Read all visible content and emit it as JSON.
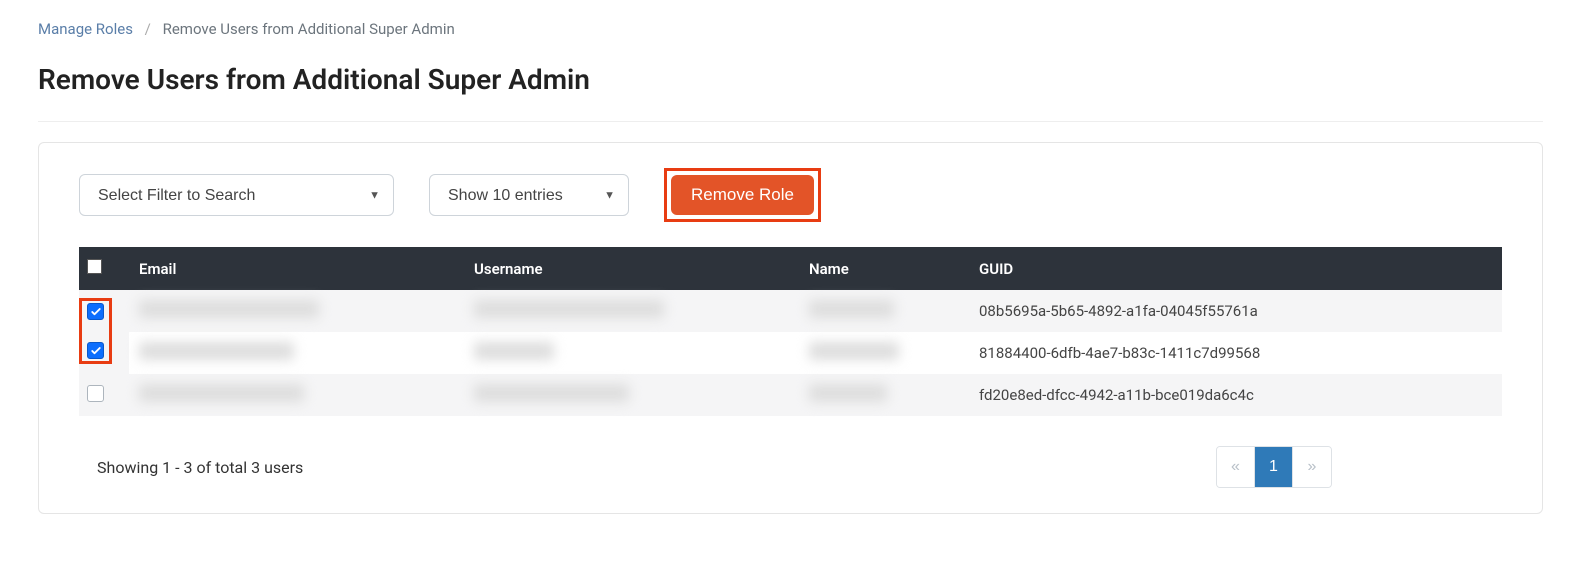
{
  "breadcrumb": {
    "root": "Manage Roles",
    "current": "Remove Users from Additional Super Admin"
  },
  "title": "Remove Users from Additional Super Admin",
  "toolbar": {
    "filter_placeholder": "Select Filter to Search",
    "entries_label": "Show 10 entries",
    "remove_label": "Remove Role"
  },
  "table": {
    "headers": {
      "email": "Email",
      "username": "Username",
      "name": "Name",
      "guid": "GUID"
    },
    "rows": [
      {
        "checked": true,
        "email": "",
        "username": "",
        "name": "",
        "guid": "08b5695a-5b65-4892-a1fa-04045f55761a"
      },
      {
        "checked": true,
        "email": "",
        "username": "",
        "name": "",
        "guid": "81884400-6dfb-4ae7-b83c-1411c7d99568"
      },
      {
        "checked": false,
        "email": "",
        "username": "",
        "name": "",
        "guid": "fd20e8ed-dfcc-4942-a11b-bce019da6c4c"
      }
    ]
  },
  "footer": {
    "showing_text": "Showing 1 - 3 of total 3 users"
  },
  "pagination": {
    "prev": "«",
    "page": "1",
    "next": "»"
  }
}
